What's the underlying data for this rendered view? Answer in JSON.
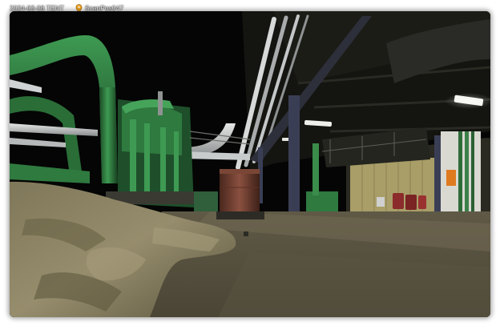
{
  "overlay": {
    "date_label": "2024-03-08 TENT",
    "scan_label": "ScanPos047",
    "icons": {
      "scan": "map-pin-icon"
    },
    "colors": {
      "pin": "#f2a623",
      "text": "#ffffff"
    }
  },
  "scene": {
    "palette": {
      "pipe_green": "#2f7a3f",
      "pipe_green_dark": "#1e4f2a",
      "pipe_silver": "#bfc2c2",
      "floor": "#6b6450",
      "tarp": "#8d8567",
      "tank_brown": "#6b3a2c",
      "ceiling": "#161612",
      "yellow_panel": "#bfb27a"
    }
  }
}
